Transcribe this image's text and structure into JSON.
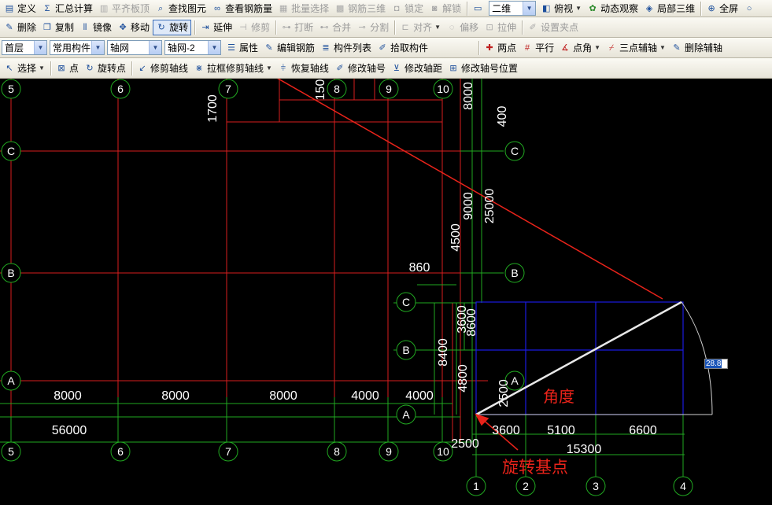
{
  "toolbar1": {
    "items": [
      {
        "label": "定义",
        "icon": "define-icon",
        "disabled": false
      },
      {
        "label": "汇总计算",
        "icon": "sigma-icon",
        "disabled": false
      },
      {
        "label": "平齐板顶",
        "icon": "align-slab-icon",
        "disabled": true
      },
      {
        "label": "查找图元",
        "icon": "find-icon",
        "disabled": false
      },
      {
        "label": "查看钢筋量",
        "icon": "rebar-view-icon",
        "disabled": false
      },
      {
        "label": "批量选择",
        "icon": "batch-select-icon",
        "disabled": true
      },
      {
        "label": "钢筋三维",
        "icon": "rebar-3d-icon",
        "disabled": true
      },
      {
        "label": "锁定",
        "icon": "lock-icon",
        "disabled": true
      },
      {
        "label": "解锁",
        "icon": "unlock-icon",
        "disabled": true
      }
    ],
    "view_select": "二维",
    "view_items": [
      {
        "label": "俯视",
        "icon": "top-view-icon"
      },
      {
        "label": "动态观察",
        "icon": "orbit-icon"
      },
      {
        "label": "局部三维",
        "icon": "local-3d-icon"
      },
      {
        "label": "全屏",
        "icon": "fullscreen-icon"
      }
    ]
  },
  "toolbar2": {
    "items": [
      {
        "label": "删除",
        "icon": "delete-icon",
        "disabled": false
      },
      {
        "label": "复制",
        "icon": "copy-icon",
        "disabled": false
      },
      {
        "label": "镜像",
        "icon": "mirror-icon",
        "disabled": false
      },
      {
        "label": "移动",
        "icon": "move-icon",
        "disabled": false
      },
      {
        "label": "旋转",
        "icon": "rotate-icon",
        "disabled": false,
        "active": true
      },
      {
        "label": "延伸",
        "icon": "extend-icon",
        "disabled": false
      },
      {
        "label": "修剪",
        "icon": "trim-icon",
        "disabled": true
      },
      {
        "label": "打断",
        "icon": "break-icon",
        "disabled": true
      },
      {
        "label": "合并",
        "icon": "merge-icon",
        "disabled": true
      },
      {
        "label": "分割",
        "icon": "split-icon",
        "disabled": true
      },
      {
        "label": "对齐",
        "icon": "align-icon",
        "disabled": true
      },
      {
        "label": "偏移",
        "icon": "offset-icon",
        "disabled": true
      },
      {
        "label": "拉伸",
        "icon": "stretch-icon",
        "disabled": true
      },
      {
        "label": "设置夹点",
        "icon": "grip-icon",
        "disabled": true
      }
    ]
  },
  "toolbar3": {
    "floor": "首层",
    "category": "常用构件",
    "type": "轴网",
    "instance": "轴网-2",
    "items": [
      {
        "label": "属性",
        "icon": "property-icon"
      },
      {
        "label": "编辑钢筋",
        "icon": "edit-rebar-icon"
      },
      {
        "label": "构件列表",
        "icon": "component-list-icon"
      },
      {
        "label": "拾取构件",
        "icon": "pick-icon"
      }
    ],
    "right_items": [
      {
        "label": "两点",
        "icon": "two-point-icon"
      },
      {
        "label": "平行",
        "icon": "parallel-icon"
      },
      {
        "label": "点角",
        "icon": "point-angle-icon"
      },
      {
        "label": "三点辅轴",
        "icon": "three-point-axis-icon"
      },
      {
        "label": "删除辅轴",
        "icon": "delete-axis-icon"
      }
    ]
  },
  "toolbar4": {
    "items": [
      {
        "label": "选择",
        "icon": "select-cursor-icon"
      },
      {
        "label": "点",
        "icon": "point-icon"
      },
      {
        "label": "旋转点",
        "icon": "rotate-point-icon"
      },
      {
        "label": "修剪轴线",
        "icon": "trim-axis-icon"
      },
      {
        "label": "拉框修剪轴线",
        "icon": "box-trim-axis-icon"
      },
      {
        "label": "恢复轴线",
        "icon": "restore-axis-icon"
      },
      {
        "label": "修改轴号",
        "icon": "edit-axis-number-icon"
      },
      {
        "label": "修改轴距",
        "icon": "edit-axis-spacing-icon"
      },
      {
        "label": "修改轴号位置",
        "icon": "axis-number-position-icon"
      }
    ]
  },
  "drawing": {
    "top_axis_labels": [
      "5",
      "6",
      "7",
      "8",
      "9",
      "10"
    ],
    "bottom_axis_labels": [
      "5",
      "6",
      "7",
      "8",
      "9",
      "10"
    ],
    "row_labels_left": [
      "C",
      "B",
      "A"
    ],
    "row_labels_right": [
      "C",
      "B"
    ],
    "dim_texts": [
      "8000",
      "8000",
      "8000",
      "4000",
      "4000",
      "56000",
      "1700",
      "150",
      "8000",
      "400",
      "9000",
      "25000",
      "4500",
      "860",
      "3600",
      "8600",
      "8400",
      "4800",
      "2500",
      "2500"
    ],
    "new_grid_cols": [
      "1",
      "2",
      "3",
      "4"
    ],
    "new_grid_rows": [
      "C",
      "B",
      "A",
      "A"
    ],
    "new_grid_dims": [
      "3600",
      "5100",
      "6600",
      "15300"
    ],
    "angle_value": "28.8",
    "annotation_angle": "角度",
    "annotation_base_point": "旋转基点"
  },
  "colors": {
    "grid_red": "#d81e1e",
    "dim_green": "#21a821",
    "new_grid_blue": "#1a1ae0",
    "annotation": "#e8231a"
  }
}
